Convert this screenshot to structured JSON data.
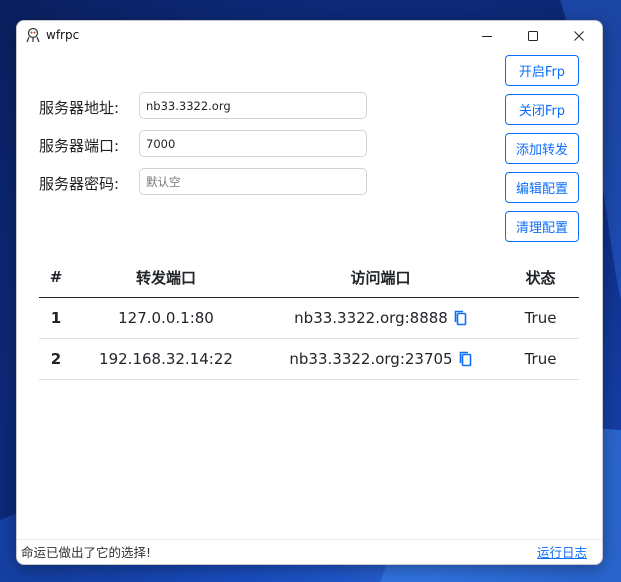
{
  "window": {
    "title": "wfrpc"
  },
  "form": {
    "server_address_label": "服务器地址:",
    "server_address_value": "nb33.3322.org",
    "server_port_label": "服务器端口:",
    "server_port_value": "7000",
    "server_password_label": "服务器密码:",
    "server_password_placeholder": "默认空"
  },
  "actions": {
    "start": "开启Frp",
    "stop": "关闭Frp",
    "add": "添加转发",
    "edit": "编辑配置",
    "clear": "清理配置"
  },
  "table": {
    "headers": {
      "index": "#",
      "forward": "转发端口",
      "visit": "访问端口",
      "status": "状态"
    },
    "rows": [
      {
        "index": "1",
        "forward": "127.0.0.1:80",
        "visit": "nb33.3322.org:8888",
        "status": "True"
      },
      {
        "index": "2",
        "forward": "192.168.32.14:22",
        "visit": "nb33.3322.org:23705",
        "status": "True"
      }
    ]
  },
  "status_bar": {
    "message": "命运已做出了它的选择!",
    "log_link": "运行日志"
  },
  "colors": {
    "accent": "#0d6efd",
    "status_ok": "#198754"
  }
}
